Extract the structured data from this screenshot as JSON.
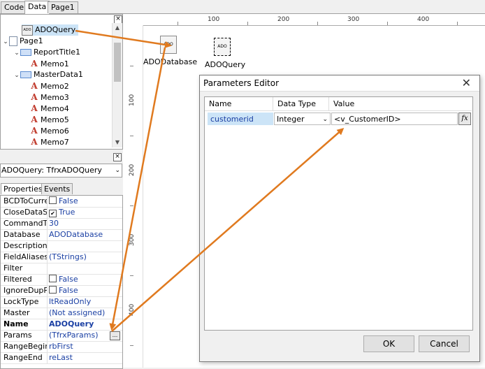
{
  "tabs": [
    {
      "label": "Code"
    },
    {
      "label": "Data"
    },
    {
      "label": "Page1"
    }
  ],
  "tree": {
    "items": [
      {
        "label": "ADOQuery",
        "icon": "ado-query-icon",
        "selected": true
      },
      {
        "label": "Page1",
        "icon": "page-icon"
      },
      {
        "label": "ReportTitle1",
        "icon": "band-icon"
      },
      {
        "label": "Memo1",
        "icon": "memo-icon"
      },
      {
        "label": "MasterData1",
        "icon": "band-icon"
      },
      {
        "label": "Memo2",
        "icon": "memo-icon"
      },
      {
        "label": "Memo3",
        "icon": "memo-icon"
      },
      {
        "label": "Memo4",
        "icon": "memo-icon"
      },
      {
        "label": "Memo5",
        "icon": "memo-icon"
      },
      {
        "label": "Memo6",
        "icon": "memo-icon"
      },
      {
        "label": "Memo7",
        "icon": "memo-icon"
      }
    ]
  },
  "object_selector": {
    "value": "ADOQuery: TfrxADOQuery"
  },
  "inspector_tabs": [
    {
      "label": "Properties"
    },
    {
      "label": "Events"
    }
  ],
  "properties": [
    {
      "name": "BCDToCurrer",
      "value": "False",
      "checkbox": "off"
    },
    {
      "name": "CloseDataSo",
      "value": "True",
      "checkbox": "on"
    },
    {
      "name": "CommandTim",
      "value": "30"
    },
    {
      "name": "Database",
      "value": "ADODatabase"
    },
    {
      "name": "Description",
      "value": ""
    },
    {
      "name": "FieldAliases",
      "value": "(TStrings)"
    },
    {
      "name": "Filter",
      "value": ""
    },
    {
      "name": "Filtered",
      "value": "False",
      "checkbox": "off"
    },
    {
      "name": "IgnoreDupPa",
      "value": "False",
      "checkbox": "off"
    },
    {
      "name": "LockType",
      "value": "ltReadOnly"
    },
    {
      "name": "Master",
      "value": "(Not assigned)"
    },
    {
      "name": "Name",
      "value": "ADOQuery",
      "bold": true
    },
    {
      "name": "Params",
      "value": "(TfrxParams)",
      "ellipsis": "..."
    },
    {
      "name": "RangeBegin",
      "value": "rbFirst"
    },
    {
      "name": "RangeEnd",
      "value": "reLast"
    }
  ],
  "ruler": {
    "h_labels": [
      "100",
      "200",
      "300",
      "400"
    ],
    "v_labels": [
      "100",
      "200",
      "300",
      "400"
    ]
  },
  "components": [
    {
      "label": "ADODatabase",
      "glyph": "ADO"
    },
    {
      "label": "ADOQuery",
      "glyph": "ADO"
    }
  ],
  "dialog": {
    "title": "Parameters Editor",
    "close_glyph": "✕",
    "columns": [
      "Name",
      "Data Type",
      "Value"
    ],
    "row": {
      "name": "customerid",
      "data_type": "Integer",
      "value": "<v_CustomerID>"
    },
    "fx": "fx",
    "ok": "OK",
    "cancel": "Cancel"
  },
  "colors": {
    "arrow": "#e07a1f",
    "selection": "#cce4f7",
    "link": "#1a3fa3"
  }
}
